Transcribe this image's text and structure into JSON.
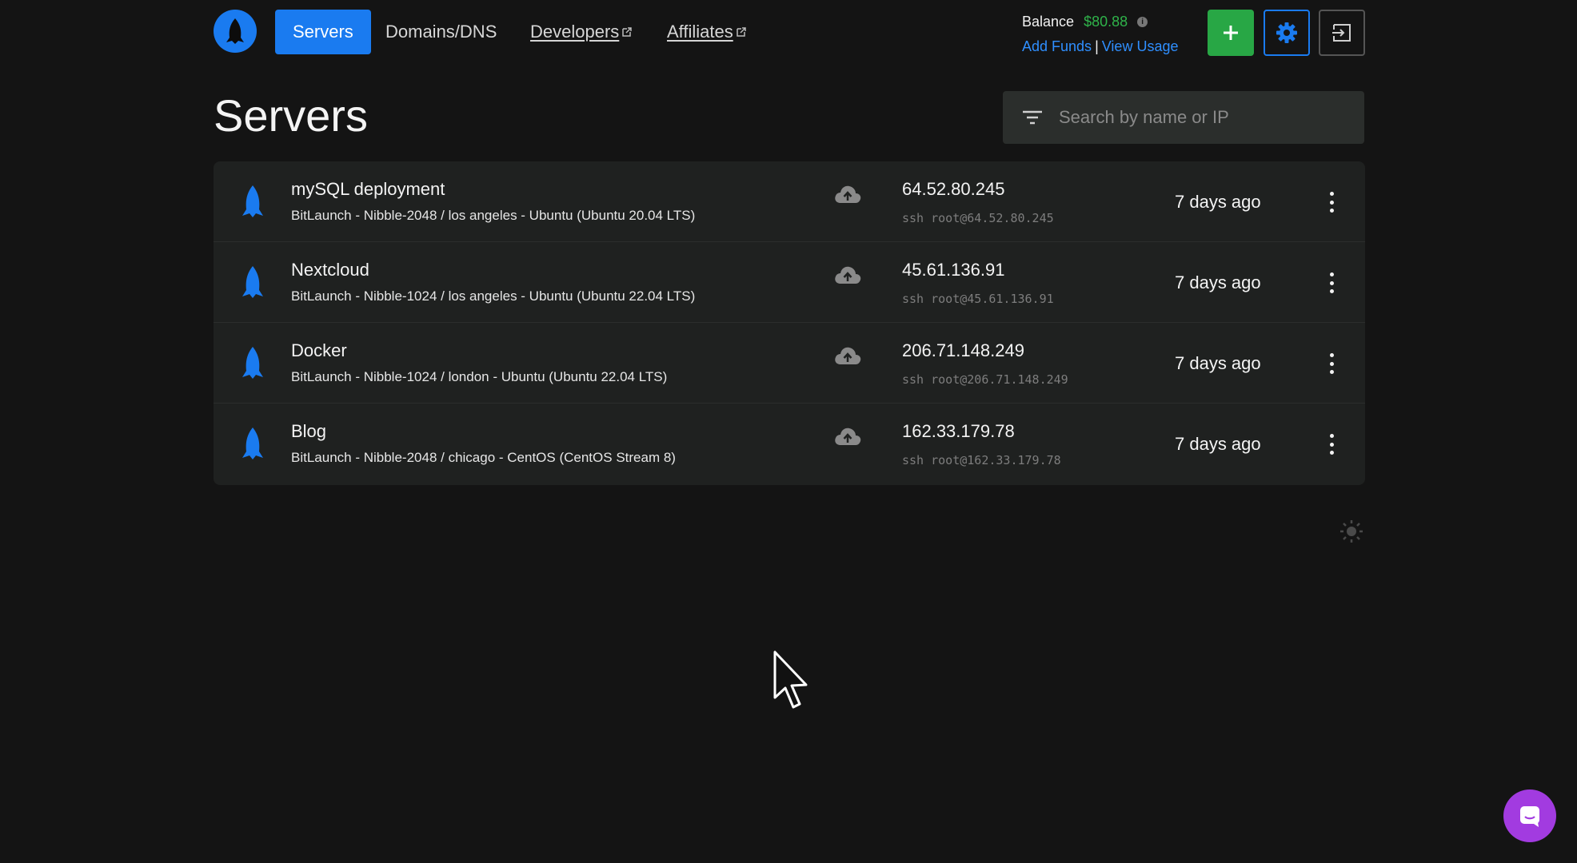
{
  "nav": {
    "items": [
      {
        "label": "Servers",
        "active": true,
        "external": false
      },
      {
        "label": "Domains/DNS",
        "active": false,
        "external": false
      },
      {
        "label": "Developers",
        "active": false,
        "external": true
      },
      {
        "label": "Affiliates",
        "active": false,
        "external": true
      }
    ]
  },
  "account": {
    "balance_label": "Balance",
    "balance_value": "$80.88",
    "add_funds": "Add Funds",
    "separator": "|",
    "view_usage": "View Usage"
  },
  "page": {
    "title": "Servers"
  },
  "search": {
    "placeholder": "Search by name or IP"
  },
  "servers": [
    {
      "name": "mySQL deployment",
      "desc": "BitLaunch - Nibble-2048 / los angeles - Ubuntu (Ubuntu 20.04 LTS)",
      "ip": "64.52.80.245",
      "ssh": "ssh root@64.52.80.245",
      "created": "7 days ago"
    },
    {
      "name": "Nextcloud",
      "desc": "BitLaunch - Nibble-1024 / los angeles - Ubuntu (Ubuntu 22.04 LTS)",
      "ip": "45.61.136.91",
      "ssh": "ssh root@45.61.136.91",
      "created": "7 days ago"
    },
    {
      "name": "Docker",
      "desc": "BitLaunch - Nibble-1024 / london - Ubuntu (Ubuntu 22.04 LTS)",
      "ip": "206.71.148.249",
      "ssh": "ssh root@206.71.148.249",
      "created": "7 days ago"
    },
    {
      "name": "Blog",
      "desc": "BitLaunch - Nibble-2048 / chicago - CentOS (CentOS Stream 8)",
      "ip": "162.33.179.78",
      "ssh": "ssh root@162.33.179.78",
      "created": "7 days ago"
    }
  ],
  "icons": {
    "logo": "rocket-logo-icon",
    "server": "rocket-icon",
    "cloud": "cloud-upload-icon",
    "menu": "kebab-menu-icon",
    "add": "plus-icon",
    "settings": "gear-icon",
    "logout": "logout-icon",
    "filter": "filter-icon",
    "theme": "sun-icon",
    "chat": "chat-icon"
  },
  "colors": {
    "background": "#141414",
    "primary": "#1a7bf0",
    "success": "#28a745",
    "balance": "#2fb34a",
    "link": "#2f8fff",
    "chat": "#a23be0"
  }
}
